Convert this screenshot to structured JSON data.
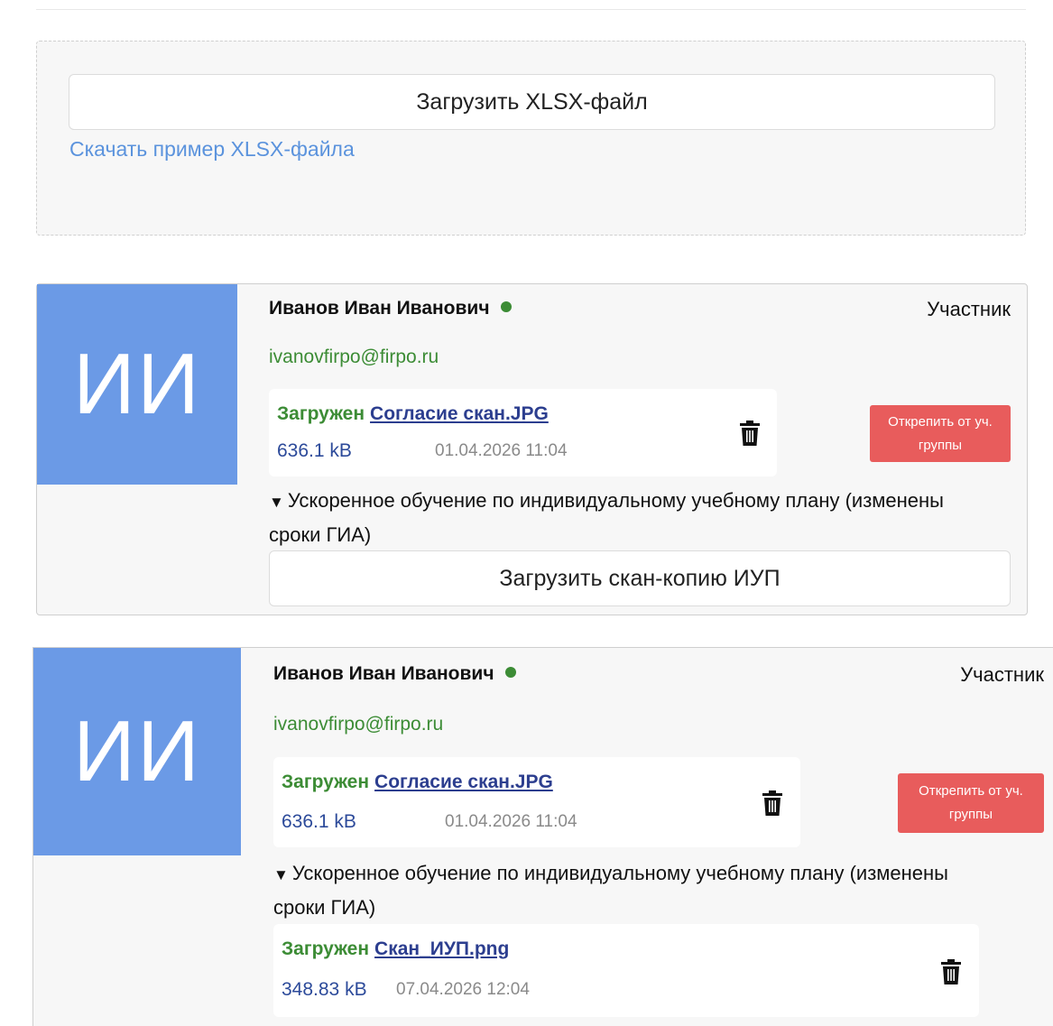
{
  "upload": {
    "button_label": "Загрузить XLSX-файл",
    "example_link": "Скачать пример XLSX-файла"
  },
  "participants": [
    {
      "avatar_initials": "ИИ",
      "name": "Иванов Иван Иванович",
      "role": "Участник",
      "email": "ivanovfirpo@firpo.ru",
      "consent_file": {
        "status": "Загружен",
        "name": "Согласие скан.JPG",
        "size": "636.1 kB",
        "date": "01.04.2026 11:04"
      },
      "detach_label": "Открепить от уч. группы",
      "program": {
        "caret": "▼",
        "title": "Ускоренное обучение по индивидуальному учебному плану (изменены сроки ГИА)"
      },
      "iup_button_label": "Загрузить скан-копию ИУП"
    },
    {
      "avatar_initials": "ИИ",
      "name": "Иванов Иван Иванович",
      "role": "Участник",
      "email": "ivanovfirpo@firpo.ru",
      "consent_file": {
        "status": "Загружен",
        "name": "Согласие скан.JPG",
        "size": "636.1 kB",
        "date": "01.04.2026 11:04"
      },
      "detach_label": "Открепить от уч. группы",
      "program": {
        "caret": "▼",
        "title": "Ускоренное обучение по индивидуальному учебному плану (изменены сроки ГИА)"
      },
      "iup_file": {
        "status": "Загружен",
        "name": "Скан_ИУП.png",
        "size": "348.83 kB",
        "date": "07.04.2026 12:04"
      }
    }
  ],
  "colors": {
    "avatar_bg": "#6b9ae6",
    "status_green": "#3c8c35",
    "detach_red": "#e85c5c",
    "link_blue": "#5b93dd",
    "file_link": "#2c3e8f"
  }
}
